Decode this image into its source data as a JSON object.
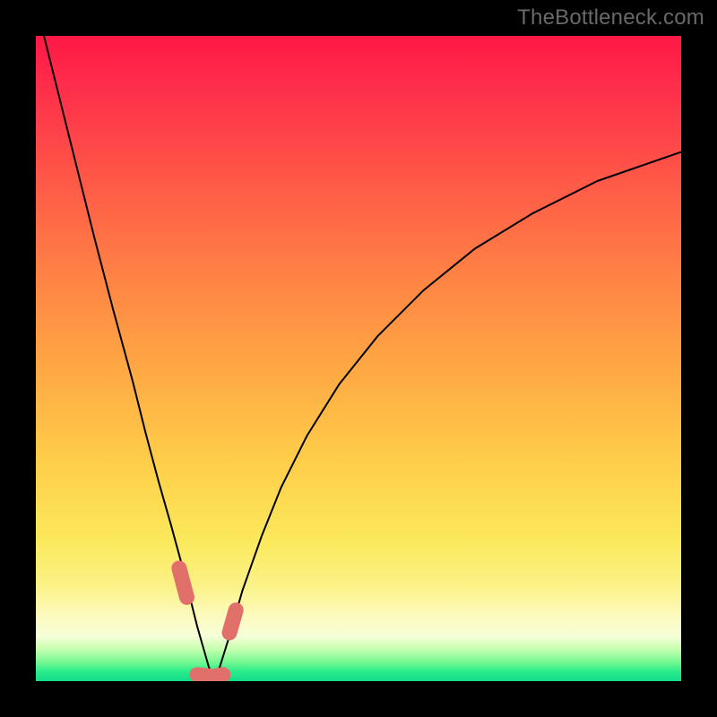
{
  "watermark_text": "TheBottleneck.com",
  "plot": {
    "inner_size_px": 720,
    "outer_size_px": 800,
    "border_px": 40
  },
  "chart_data": {
    "type": "line",
    "title": "",
    "xlabel": "",
    "ylabel": "",
    "xlim": [
      0,
      100
    ],
    "ylim": [
      0,
      100
    ],
    "grid": false,
    "legend": false,
    "notch_x": 27,
    "series": [
      {
        "name": "left",
        "x": [
          0,
          3,
          6,
          9,
          12,
          15,
          17,
          19,
          21,
          22.5,
          24,
          25,
          26,
          26.8,
          27.4
        ],
        "y": [
          105,
          93,
          81,
          69,
          57.5,
          46.5,
          38.5,
          31,
          24,
          18.5,
          12.5,
          8.5,
          5,
          2.2,
          0.8
        ]
      },
      {
        "name": "right",
        "x": [
          27.8,
          28.5,
          30,
          32,
          35,
          38,
          42,
          47,
          53,
          60,
          68,
          77,
          87,
          100
        ],
        "y": [
          0.8,
          2.2,
          7,
          14,
          22.5,
          30,
          38,
          46,
          53.5,
          60.5,
          67,
          72.5,
          77.5,
          82
        ]
      }
    ],
    "markers": [
      {
        "name": "left-band",
        "x0": 22.2,
        "y0": 17.5,
        "x1": 23.4,
        "y1": 13.0
      },
      {
        "name": "floor-left",
        "x0": 25.0,
        "y0": 1.0,
        "x1": 26.8,
        "y1": 0.8
      },
      {
        "name": "floor-right",
        "x0": 27.8,
        "y0": 0.8,
        "x1": 29.0,
        "y1": 1.0
      },
      {
        "name": "right-band",
        "x0": 30.0,
        "y0": 7.5,
        "x1": 31.0,
        "y1": 11.0
      }
    ]
  }
}
